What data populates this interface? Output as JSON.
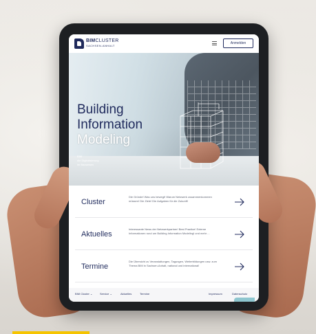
{
  "header": {
    "logo_main_bold": "BIM",
    "logo_main_light": "CLUSTER",
    "logo_sub": "SACHSEN-ANHALT",
    "login_label": "Anmelden"
  },
  "hero": {
    "title_line1": "Building",
    "title_line2": "Information",
    "title_line3": "Modeling",
    "sub_line1": "BIM",
    "sub_line2": "die Digitalisierung",
    "sub_line3": "im Bauwesen"
  },
  "cards": [
    {
      "title": "Cluster",
      "description": "Die Gründe! Was uns bewegt! Warum Netzwerk zusammenkommen müssen! Die Ziele! Die Aufgaben für die Zukunft!"
    },
    {
      "title": "Aktuelles",
      "description": "Interessante News der Netzwerkpartner! Best Practice! Externe Informationen rund um Building Information Modeling! und mehr ..."
    },
    {
      "title": "Termine",
      "description": "Die Übersicht zu Veranstaltungen, Tagungen, Weiterbildungen usw. zum Thema BIM in Sachsen-Anhalt, national und international!"
    }
  ],
  "footer": {
    "nav_bim_cluster": "BIM Cluster",
    "nav_service": "Service",
    "nav_aktuelles": "Aktuelles",
    "nav_termine": "Termine",
    "nav_impressum": "Impressum",
    "nav_datenschutz": "Datenschutz"
  },
  "colors": {
    "brand": "#1f2a5c",
    "accent_yellow": "#f5c400"
  }
}
